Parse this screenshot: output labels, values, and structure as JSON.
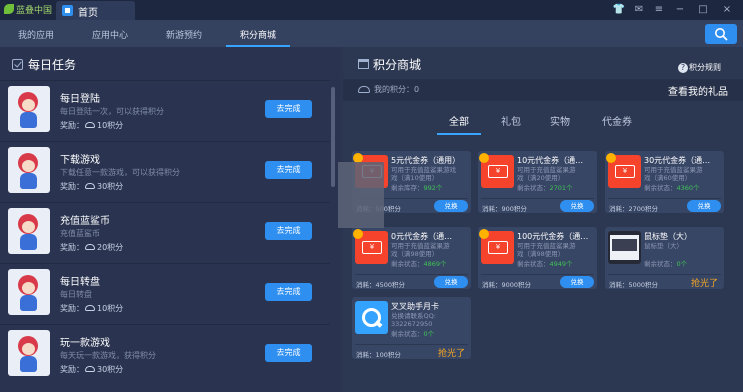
{
  "titlebar": {
    "logo": "蓝叠中国",
    "home_tab": "首页",
    "controls": [
      "👕",
      "✉",
      "≡",
      "−",
      "□",
      "×"
    ]
  },
  "nav": {
    "tabs": [
      "我的应用",
      "应用中心",
      "新游预约",
      "积分商城"
    ],
    "active": 3
  },
  "tasks": {
    "title": "每日任务",
    "reward_label": "奖励：",
    "button_label": "去完成",
    "items": [
      {
        "name": "每日登陆",
        "desc": "每日登陆一次，可以获得积分",
        "reward": "10积分"
      },
      {
        "name": "下载游戏",
        "desc": "下载任意一款游戏，可以获得积分",
        "reward": "30积分"
      },
      {
        "name": "充值蓝鲨币",
        "desc": "充值蓝鲨币",
        "reward": "20积分"
      },
      {
        "name": "每日转盘",
        "desc": "每日转盘",
        "reward": "10积分"
      },
      {
        "name": "玩一款游戏",
        "desc": "每天玩一款游戏，获得积分",
        "reward": "30积分"
      }
    ]
  },
  "shop": {
    "title": "积分商城",
    "rules": "积分规则",
    "my_points": "我的积分：0",
    "my_gifts": "查看我的礼品",
    "categories": [
      "全部",
      "礼包",
      "实物",
      "代金券"
    ],
    "active_category": 0,
    "redeem_label": "兑换",
    "sold_out_label": "抢光了",
    "items": [
      {
        "name": "5元代金券（通用）",
        "desc1": "可用于充值蓝鲨果游戏",
        "desc2": "戏（满10使用）",
        "stock_label": "剩余库存：",
        "stock": "992个",
        "cost": "消耗：500积分",
        "status": "redeem",
        "thumb": "voucher"
      },
      {
        "name": "10元代金券（通…",
        "desc1": "可用于充值蓝鲨果游",
        "desc2": "戏（满20使用）",
        "stock_label": "剩余状态：",
        "stock": "2701个",
        "cost": "消耗：900积分",
        "status": "redeem",
        "thumb": "voucher"
      },
      {
        "name": "30元代金券（通…",
        "desc1": "可用于充值蓝鲨果游",
        "desc2": "戏（满60使用）",
        "stock_label": "剩余状态：",
        "stock": "4360个",
        "cost": "消耗：2700积分",
        "status": "redeem",
        "thumb": "voucher"
      },
      {
        "name": "0元代金券（通…",
        "desc1": "可用于充值蓝鲨果游",
        "desc2": "戏（满98使用）",
        "stock_label": "剩余状态：",
        "stock": "4869个",
        "cost": "消耗：4500积分",
        "status": "redeem",
        "thumb": "voucher"
      },
      {
        "name": "100元代金券（通…",
        "desc1": "可用于充值蓝鲨果游",
        "desc2": "戏（满98使用）",
        "stock_label": "剩余状态：",
        "stock": "4949个",
        "cost": "消耗：9000积分",
        "status": "redeem",
        "thumb": "voucher"
      },
      {
        "name": "鼠标垫（大）",
        "desc1": "鼠标垫（大）",
        "desc2": "",
        "stock_label": "剩余状态：",
        "stock": "0个",
        "cost": "消耗：5000积分",
        "status": "sold",
        "thumb": "photo"
      },
      {
        "name": "叉叉助手月卡",
        "desc1": "兑换请联系QQ:",
        "desc2": "3322672950",
        "stock_label": "剩余状态：",
        "stock": "0个",
        "cost": "消耗：100积分",
        "status": "sold",
        "thumb": "app"
      }
    ]
  },
  "colors": {
    "accent": "#2f8ff0",
    "panel_left": "#2a3450",
    "panel_right": "#2c3752",
    "card": "#384665",
    "stock_green": "#3fc356",
    "sold_orange": "#f5a623"
  }
}
